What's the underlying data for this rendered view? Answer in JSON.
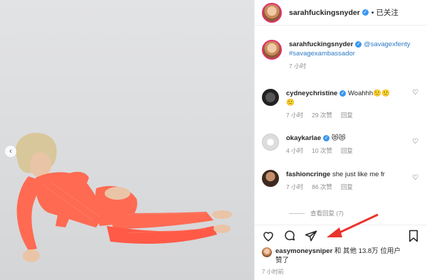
{
  "post": {
    "author": "sarahfuckingsnyder",
    "follow_label": "• 已关注",
    "caption_mention": "@savagexfenty",
    "caption_tag": "#savagexambassador",
    "caption_time": "7 小时"
  },
  "comments": [
    {
      "user": "cydneychristine",
      "text": "Woahhh🙂🙂",
      "text2": "🙂",
      "time": "7 小时",
      "likes": "29 次赞",
      "reply": "回复",
      "verified": true
    },
    {
      "user": "okaykarlae",
      "text": "😻😻",
      "time": "4 小时",
      "likes": "10 次赞",
      "reply": "回复",
      "verified": true
    },
    {
      "user": "fashioncringe",
      "text": "she just like me fr",
      "time": "7 小时",
      "likes": "86 次赞",
      "reply": "回复",
      "verified": false
    }
  ],
  "view_replies": "查看回复 (7)",
  "likes_line": {
    "user": "easymoneysniper",
    "rest": "和 其他 13.8万 位用户",
    "rest2": "赞了"
  },
  "post_time": "7 小时前",
  "icons": [
    "heart-icon",
    "comment-icon",
    "share-icon",
    "bookmark-icon"
  ],
  "colors": {
    "accent": "#3897f0",
    "arrow": "#e8342c",
    "outfit": "#ff6a52"
  }
}
